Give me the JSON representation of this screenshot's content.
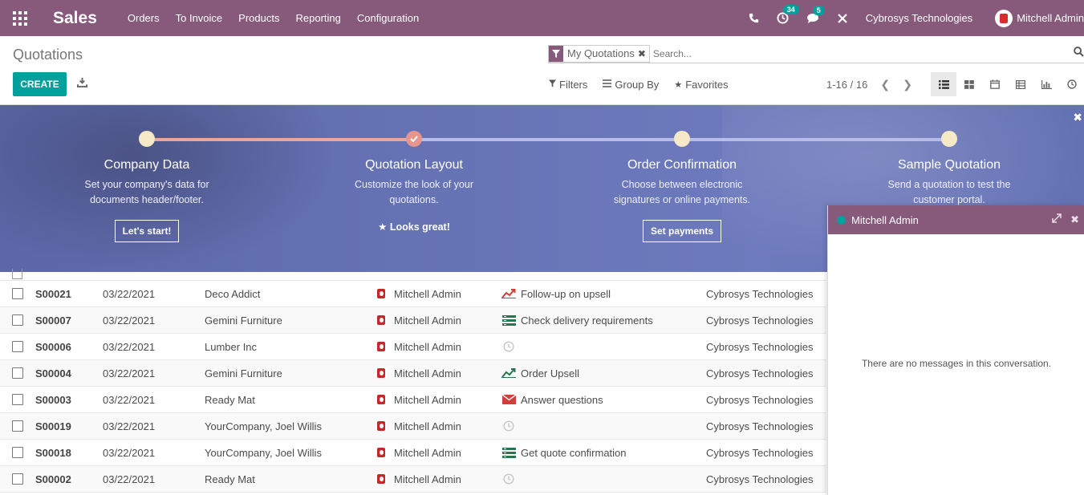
{
  "navbar": {
    "brand": "Sales",
    "menu": [
      "Orders",
      "To Invoice",
      "Products",
      "Reporting",
      "Configuration"
    ],
    "activity_badge": "34",
    "messages_badge": "5",
    "company": "Cybrosys Technologies",
    "user": "Mitchell Admin"
  },
  "control": {
    "breadcrumb": "Quotations",
    "create_label": "CREATE",
    "facet_label": "My Quotations",
    "search_placeholder": "Search...",
    "filters_label": "Filters",
    "groupby_label": "Group By",
    "favorites_label": "Favorites",
    "pager": "1-16 / 16"
  },
  "banner": {
    "steps": [
      {
        "title": "Company Data",
        "desc1": "Set your company's data for",
        "desc2": "documents header/footer.",
        "button": "Let's start!"
      },
      {
        "title": "Quotation Layout",
        "desc1": "Customize the look of your",
        "desc2": "quotations.",
        "done": "Looks great!"
      },
      {
        "title": "Order Confirmation",
        "desc1": "Choose between electronic",
        "desc2": "signatures or online payments.",
        "button": "Set payments"
      },
      {
        "title": "Sample Quotation",
        "desc1": "Send a quotation to test the",
        "desc2": "customer portal."
      }
    ]
  },
  "rows": [
    {
      "number": "S00021",
      "date": "03/22/2021",
      "customer": "Deco Addict",
      "salesperson": "Mitchell Admin",
      "activity": "Follow-up on upsell",
      "activity_icon": "trend-up-red-icon",
      "company": "Cybrosys Technologies"
    },
    {
      "number": "S00007",
      "date": "03/22/2021",
      "customer": "Gemini Furniture",
      "salesperson": "Mitchell Admin",
      "activity": "Check delivery requirements",
      "activity_icon": "task-list-icon",
      "company": "Cybrosys Technologies"
    },
    {
      "number": "S00006",
      "date": "03/22/2021",
      "customer": "Lumber Inc",
      "salesperson": "Mitchell Admin",
      "activity": "",
      "activity_icon": "clock-icon",
      "company": "Cybrosys Technologies"
    },
    {
      "number": "S00004",
      "date": "03/22/2021",
      "customer": "Gemini Furniture",
      "salesperson": "Mitchell Admin",
      "activity": "Order Upsell",
      "activity_icon": "trend-up-green-icon",
      "company": "Cybrosys Technologies"
    },
    {
      "number": "S00003",
      "date": "03/22/2021",
      "customer": "Ready Mat",
      "salesperson": "Mitchell Admin",
      "activity": "Answer questions",
      "activity_icon": "envelope-icon",
      "company": "Cybrosys Technologies"
    },
    {
      "number": "S00019",
      "date": "03/22/2021",
      "customer": "YourCompany, Joel Willis",
      "salesperson": "Mitchell Admin",
      "activity": "",
      "activity_icon": "clock-icon",
      "company": "Cybrosys Technologies"
    },
    {
      "number": "S00018",
      "date": "03/22/2021",
      "customer": "YourCompany, Joel Willis",
      "salesperson": "Mitchell Admin",
      "activity": "Get quote confirmation",
      "activity_icon": "task-list-icon",
      "company": "Cybrosys Technologies"
    },
    {
      "number": "S00002",
      "date": "03/22/2021",
      "customer": "Ready Mat",
      "salesperson": "Mitchell Admin",
      "activity": "",
      "activity_icon": "clock-icon",
      "company": "Cybrosys Technologies"
    }
  ],
  "chat": {
    "name": "Mitchell Admin",
    "empty_message": "There are no messages in this conversation."
  }
}
